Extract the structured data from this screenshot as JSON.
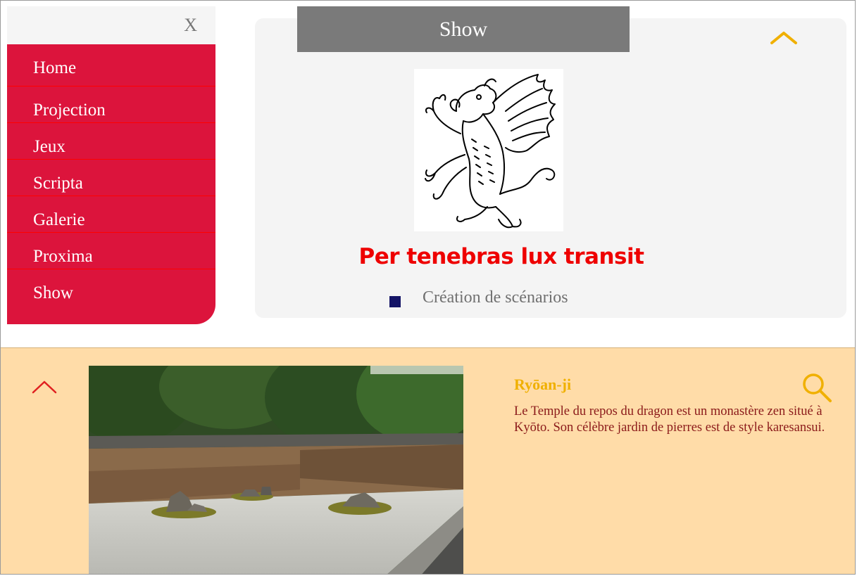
{
  "sidebar": {
    "close_label": "X",
    "items": [
      {
        "label": "Home"
      },
      {
        "label": "Projection"
      },
      {
        "label": "Jeux"
      },
      {
        "label": "Scripta"
      },
      {
        "label": "Galerie"
      },
      {
        "label": "Proxima"
      },
      {
        "label": "Show"
      }
    ]
  },
  "show": {
    "tab_label": "Show",
    "motto": "Per tenebras lux transit",
    "bullet_text": "Création de scénarios",
    "emblem_icon": "griffin-emblem",
    "collapse_icon": "chevron-up-icon"
  },
  "article": {
    "title": "Ryōan-ji",
    "text": "Le Temple du repos du dragon est un monastère zen situé à Kyōto. Son célèbre jardin de pierres est de style karesansui.",
    "search_icon": "search-icon",
    "collapse_icon": "chevron-up-icon"
  },
  "colors": {
    "menu_bg": "#dc143c",
    "menu_divider": "#ff0000",
    "show_tab_bg": "#7a7a7a",
    "motto": "#ee0000",
    "accent_gold": "#f0b000",
    "bottom_bg": "#ffdca8",
    "article_text": "#8b1a1a",
    "bullet": "#141466"
  }
}
